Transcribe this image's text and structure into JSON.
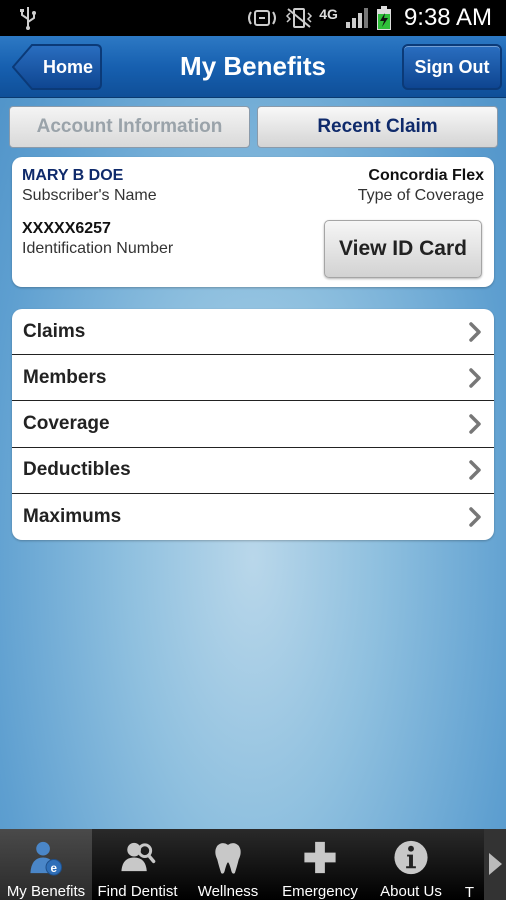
{
  "status_bar": {
    "time": "9:38 AM",
    "network": "4G"
  },
  "header": {
    "home_label": "Home",
    "title": "My Benefits",
    "signout_label": "Sign Out"
  },
  "tabs": [
    {
      "label": "Account Information",
      "active": false
    },
    {
      "label": "Recent Claim",
      "active": true
    }
  ],
  "subscriber": {
    "name": "MARY B DOE",
    "name_label": "Subscriber's Name",
    "coverage": "Concordia Flex",
    "coverage_label": "Type of Coverage",
    "id_number": "XXXXX6257",
    "id_label": "Identification Number",
    "view_id_card_label": "View ID Card"
  },
  "menu": {
    "items": [
      {
        "label": "Claims"
      },
      {
        "label": "Members"
      },
      {
        "label": "Coverage"
      },
      {
        "label": "Deductibles"
      },
      {
        "label": "Maximums"
      }
    ]
  },
  "bottom_nav": {
    "items": [
      {
        "label": "My Benefits",
        "icon": "my-benefits-icon",
        "active": true
      },
      {
        "label": "Find Dentist",
        "icon": "find-dentist-icon",
        "active": false
      },
      {
        "label": "Wellness",
        "icon": "tooth-icon",
        "active": false
      },
      {
        "label": "Emergency",
        "icon": "cross-icon",
        "active": false
      },
      {
        "label": "About Us",
        "icon": "info-icon",
        "active": false
      },
      {
        "label": "T",
        "icon": "",
        "active": false
      }
    ]
  },
  "colors": {
    "header_blue": "#1760b0",
    "navy_text": "#0f2a6b",
    "background_blue": "#8fc0df"
  }
}
